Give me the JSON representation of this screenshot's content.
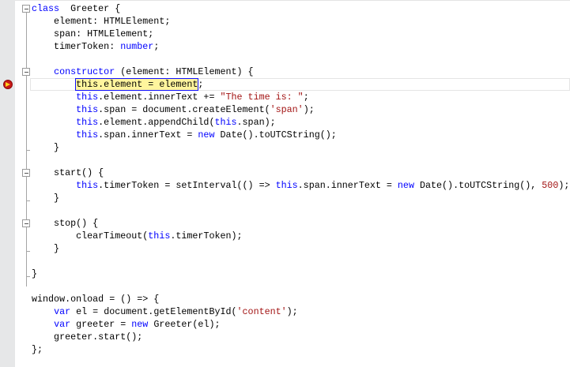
{
  "editor": {
    "current_line": 6,
    "highlight": {
      "line": 6,
      "text": "this.element = element"
    },
    "fold_lines": [
      0,
      5,
      13,
      17
    ],
    "lines": [
      [
        [
          "kw",
          "class"
        ],
        [
          "",
          "  Greeter {"
        ]
      ],
      [
        [
          "",
          "    element: HTMLElement;"
        ]
      ],
      [
        [
          "",
          "    span: HTMLElement;"
        ]
      ],
      [
        [
          "",
          "    timerToken: "
        ],
        [
          "kw",
          "number"
        ],
        [
          "",
          ";"
        ]
      ],
      [],
      [
        [
          "",
          "    "
        ],
        [
          "kw",
          "constructor"
        ],
        [
          "",
          " (element: HTMLElement) {"
        ]
      ],
      [
        [
          "",
          "        "
        ],
        [
          "hl",
          "this.element = element"
        ],
        [
          "",
          ";"
        ]
      ],
      [
        [
          "",
          "        "
        ],
        [
          "kw",
          "this"
        ],
        [
          "",
          ".element.innerText += "
        ],
        [
          "str",
          "\"The time is: \""
        ],
        [
          "",
          ";"
        ]
      ],
      [
        [
          "",
          "        "
        ],
        [
          "kw",
          "this"
        ],
        [
          "",
          ".span = document.createElement("
        ],
        [
          "str",
          "'span'"
        ],
        [
          "",
          ");"
        ]
      ],
      [
        [
          "",
          "        "
        ],
        [
          "kw",
          "this"
        ],
        [
          "",
          ".element.appendChild("
        ],
        [
          "kw",
          "this"
        ],
        [
          "",
          ".span);"
        ]
      ],
      [
        [
          "",
          "        "
        ],
        [
          "kw",
          "this"
        ],
        [
          "",
          ".span.innerText = "
        ],
        [
          "kw",
          "new"
        ],
        [
          "",
          " Date().toUTCString();"
        ]
      ],
      [
        [
          "",
          "    }"
        ]
      ],
      [],
      [
        [
          "",
          "    start() {"
        ]
      ],
      [
        [
          "",
          "        "
        ],
        [
          "kw",
          "this"
        ],
        [
          "",
          ".timerToken = setInterval(() => "
        ],
        [
          "kw",
          "this"
        ],
        [
          "",
          ".span.innerText = "
        ],
        [
          "kw",
          "new"
        ],
        [
          "",
          " Date().toUTCString(), "
        ],
        [
          "str",
          "500"
        ],
        [
          "",
          ");"
        ]
      ],
      [
        [
          "",
          "    }"
        ]
      ],
      [],
      [
        [
          "",
          "    stop() {"
        ]
      ],
      [
        [
          "",
          "        clearTimeout("
        ],
        [
          "kw",
          "this"
        ],
        [
          "",
          ".timerToken);"
        ]
      ],
      [
        [
          "",
          "    }"
        ]
      ],
      [],
      [
        [
          "",
          "}"
        ]
      ],
      [],
      [
        [
          "",
          "window.onload = () => {"
        ]
      ],
      [
        [
          "",
          "    "
        ],
        [
          "kw",
          "var"
        ],
        [
          "",
          " el = document.getElementById("
        ],
        [
          "str",
          "'content'"
        ],
        [
          "",
          ");"
        ]
      ],
      [
        [
          "",
          "    "
        ],
        [
          "kw",
          "var"
        ],
        [
          "",
          " greeter = "
        ],
        [
          "kw",
          "new"
        ],
        [
          "",
          " Greeter(el);"
        ]
      ],
      [
        [
          "",
          "    greeter.start();"
        ]
      ],
      [
        [
          "",
          "};"
        ]
      ]
    ]
  }
}
